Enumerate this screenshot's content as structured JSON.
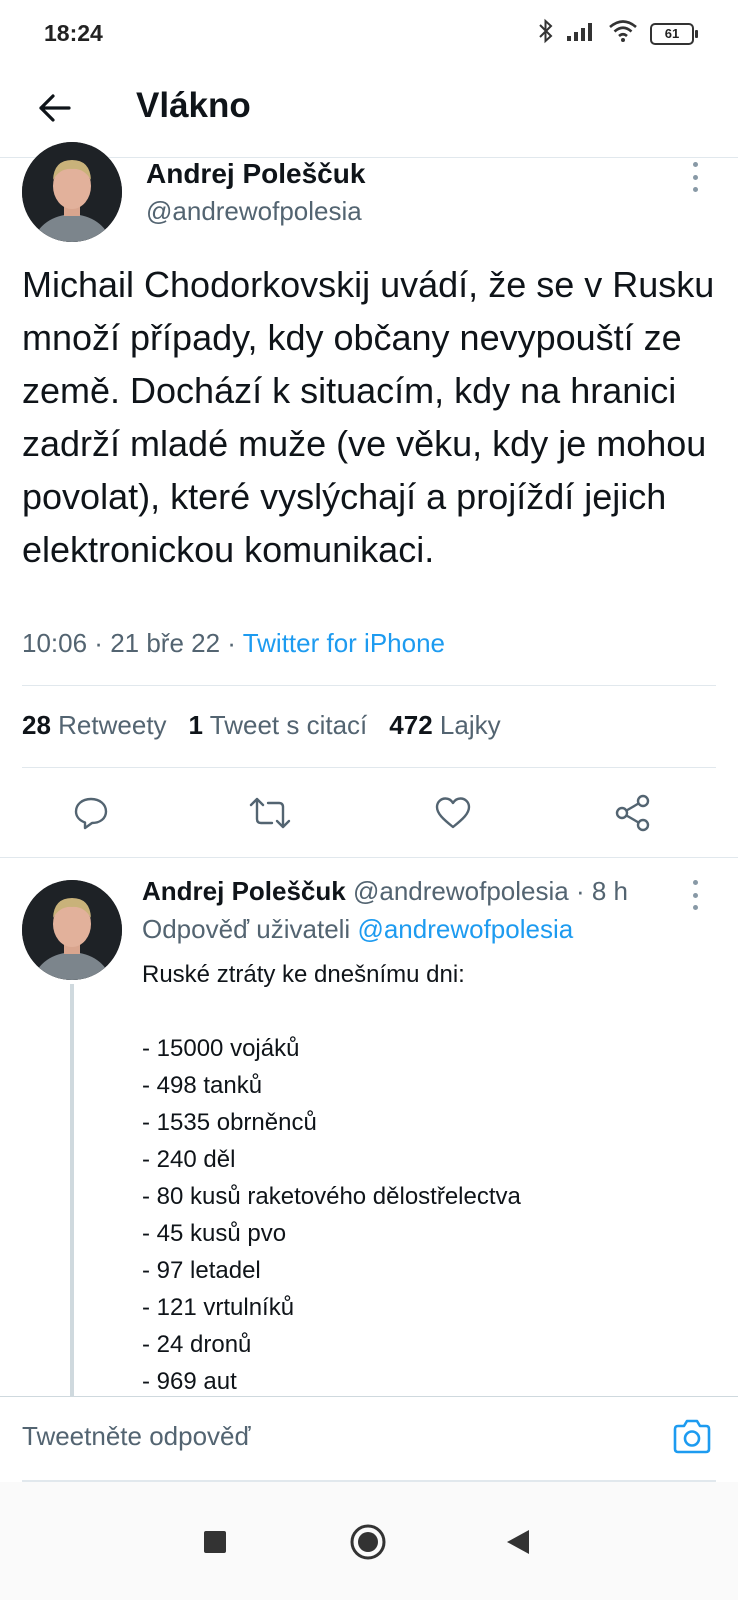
{
  "status": {
    "time": "18:24",
    "battery": "61"
  },
  "header": {
    "title": "Vlákno"
  },
  "main_tweet": {
    "author_name": "Andrej Poleščuk",
    "author_handle": "@andrewofpolesia",
    "text": "Michail Chodorkovskij uvádí, že se v Rusku množí případy, kdy občany nevypouští ze země. Dochází k situacím, kdy na hranici zadrží mladé muže (ve věku, kdy je mohou povolat), které vyslýchají a projíždí jejich elektronickou komunikaci.",
    "time": "10:06",
    "date": "21 bře 22",
    "source": "Twitter for iPhone",
    "retweets_count": "28",
    "retweets_label": "Retweety",
    "quotes_count": "1",
    "quotes_label": "Tweet s citací",
    "likes_count": "472",
    "likes_label": "Lajky"
  },
  "reply": {
    "author_name": "Andrej Poleščuk",
    "author_handle": "@andrewofpolesia",
    "age": "8 h",
    "reply_to_label": "Odpověď uživateli",
    "reply_to_handle": "@andrewofpolesia",
    "text": "Ruské ztráty ke dnešnímu dni:\n\n- 15000 vojáků\n- 498 tanků\n- 1535 obrněnců\n- 240 děl\n- 80 kusů raketového dělostřelectva\n- 45 kusů pvo\n- 97 letadel\n- 121 vrtulníků\n- 24 dronů\n- 969 aut"
  },
  "compose": {
    "placeholder": "Tweetněte odpověď"
  },
  "colors": {
    "accent": "#1d9bf0",
    "muted": "#536471",
    "text": "#0f1419"
  }
}
